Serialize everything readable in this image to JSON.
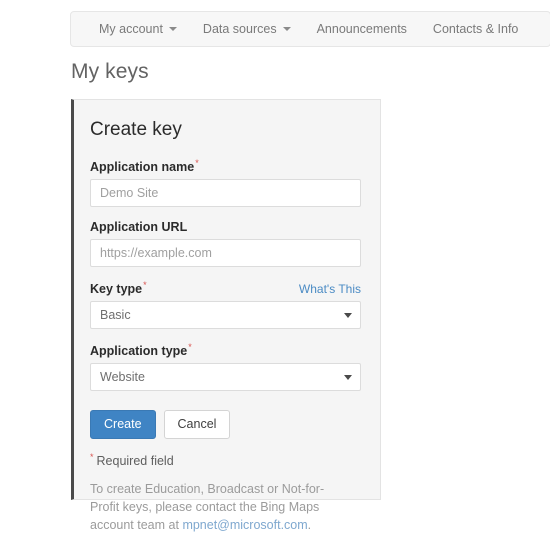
{
  "navbar": {
    "items": [
      {
        "label": "My account",
        "caret": true,
        "icon": "chevron-down-icon"
      },
      {
        "label": "Data sources",
        "caret": true,
        "icon": "chevron-down-icon"
      },
      {
        "label": "Announcements",
        "caret": false
      },
      {
        "label": "Contacts & Info",
        "caret": false
      }
    ]
  },
  "page": {
    "title": "My keys"
  },
  "panel": {
    "title": "Create key",
    "accent_color": "#4a4a4a",
    "background_color": "#f5f5f5"
  },
  "form": {
    "application_name": {
      "label": "Application name",
      "required_marker": "*",
      "value": "Demo Site",
      "placeholder": "Demo Site"
    },
    "application_url": {
      "label": "Application URL",
      "value": "https://example.com",
      "placeholder": "https://example.com"
    },
    "key_type": {
      "label": "Key type",
      "required_marker": "*",
      "help_link": "What's This",
      "selected": "Basic",
      "options": [
        "Basic"
      ]
    },
    "application_type": {
      "label": "Application type",
      "required_marker": "*",
      "selected": "Website",
      "options": [
        "Website"
      ]
    }
  },
  "buttons": {
    "create": "Create",
    "cancel": "Cancel",
    "primary_color": "#3f84c4"
  },
  "notes": {
    "required_marker": "*",
    "required_field": "Required field",
    "contact_line1": "To create Education, Broadcast or Not-for-Profit keys,",
    "contact_line2": "please contact the Bing Maps account team at",
    "contact_email": "mpnet@microsoft.com",
    "contact_period": "."
  }
}
